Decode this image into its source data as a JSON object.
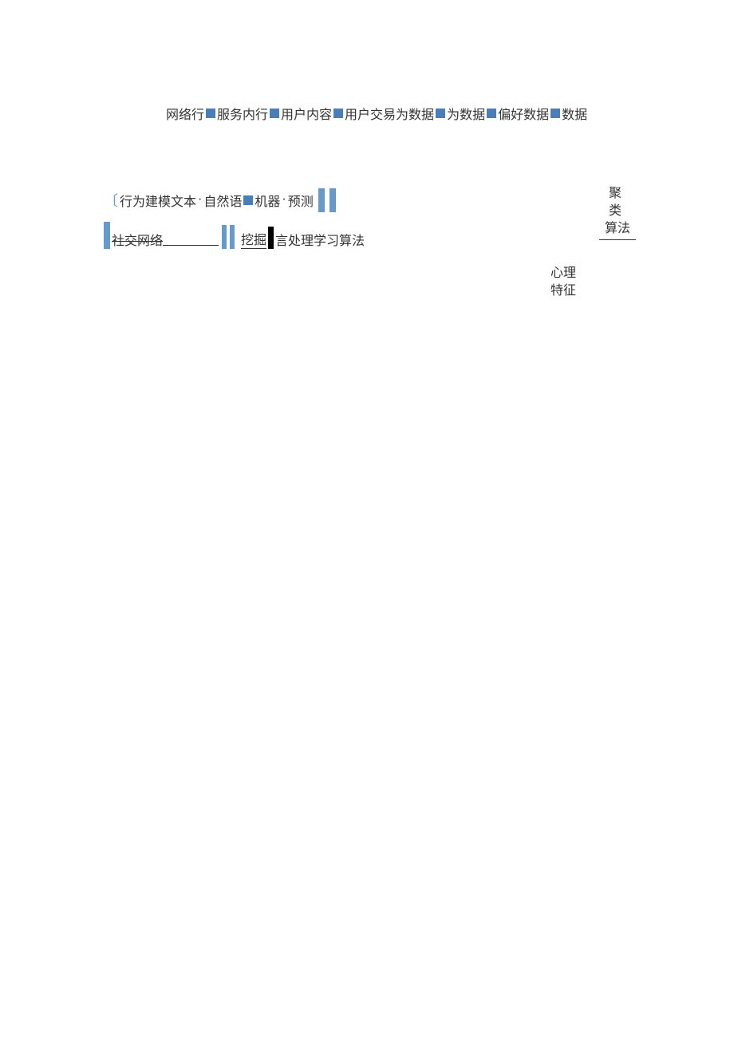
{
  "top_row": {
    "t0": "网络行",
    "t1": "服务内行",
    "t2": "用户内容",
    "t3": "用户交易为数据",
    "t4": "为数据",
    "t5": "偏好数据",
    "t6": "数据"
  },
  "mid1": {
    "bracket": "〔",
    "seg1": "行为建模文本",
    "dot": "·",
    "seg2": "自然语",
    "seg3": "机器",
    "seg4": "预测"
  },
  "mid2": {
    "seg1": "社交网络",
    "seg2": "挖掘",
    "seg3": "言处理学习算法"
  },
  "right1": {
    "ln1": "聚 类",
    "ln2": "算法"
  },
  "right2": {
    "ln1": "心理",
    "ln2": "特征"
  }
}
